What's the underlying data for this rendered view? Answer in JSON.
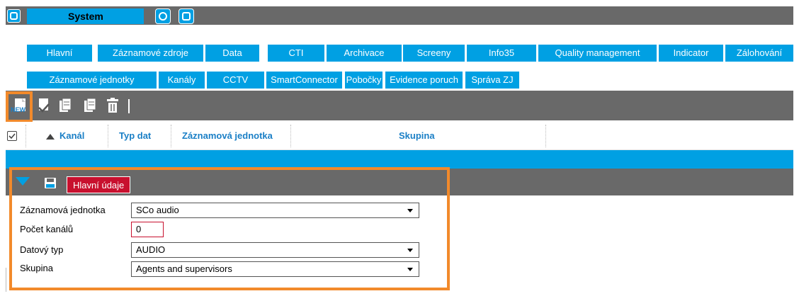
{
  "app": {
    "title": "System"
  },
  "tabs_row1": [
    "Hlavní",
    "Záznamové zdroje",
    "Data",
    "CTI",
    "Archivace",
    "Screeny",
    "Info35",
    "Quality management",
    "Indicator",
    "Zálohování"
  ],
  "tabs_row2": [
    "Záznamové jednotky",
    "Kanály",
    "CCTV",
    "SmartConnector",
    "Pobočky",
    "Evidence poruch",
    "Správa ZJ"
  ],
  "toolbar": {
    "new_label": "NEW",
    "icons": [
      "new-icon",
      "edit-check-icon",
      "copy-icon",
      "copy-icon",
      "trash-icon"
    ]
  },
  "grid": {
    "headers": {
      "kanal": "Kanál",
      "typ_dat": "Typ dat",
      "zaznamova_jednotka": "Záznamová jednotka",
      "skupina": "Skupina"
    }
  },
  "panel": {
    "tab_label": "Hlavní údaje"
  },
  "form": {
    "zaznamova_jednotka": {
      "label": "Záznamová jednotka",
      "value": "SCo audio"
    },
    "pocet_kanalu": {
      "label": "Počet kanálů",
      "value": "0"
    },
    "datovy_typ": {
      "label": "Datový typ",
      "value": "AUDIO"
    },
    "skupina": {
      "label": "Skupina",
      "value": "Agents and supervisors"
    }
  },
  "colors": {
    "accent": "#00a0e3",
    "toolbar_gray": "#696969",
    "highlight": "#f28a2b",
    "active_tab": "#c8102e"
  }
}
